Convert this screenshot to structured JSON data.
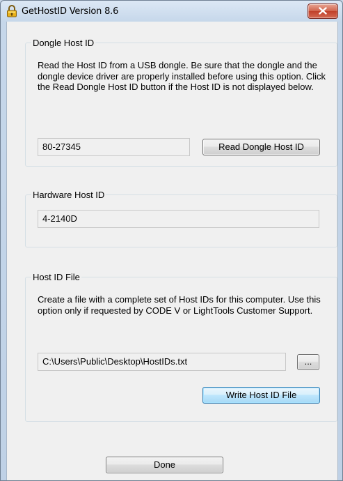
{
  "window": {
    "title": "GetHostID Version 8.6"
  },
  "dongle": {
    "group_title": "Dongle Host ID",
    "description": "Read the Host ID from a USB dongle.  Be sure that the dongle and the dongle device driver are properly installed before using this option.  Click the Read Dongle Host ID button if the Host ID is not displayed below.",
    "host_id": "80-27345",
    "read_button_label": "Read Dongle Host ID"
  },
  "hardware": {
    "group_title": "Hardware Host ID",
    "host_id": "4-2140D"
  },
  "hostid_file": {
    "group_title": "Host ID File",
    "description": "Create a file with a complete set of Host IDs for this computer. Use this option only if requested by CODE V or LightTools Customer Support.",
    "file_path": "C:\\Users\\Public\\Desktop\\HostIDs.txt",
    "browse_label": "...",
    "write_button_label": "Write Host ID File"
  },
  "done_button_label": "Done",
  "icons": {
    "app": "padlock-key-icon",
    "close": "close-icon"
  }
}
